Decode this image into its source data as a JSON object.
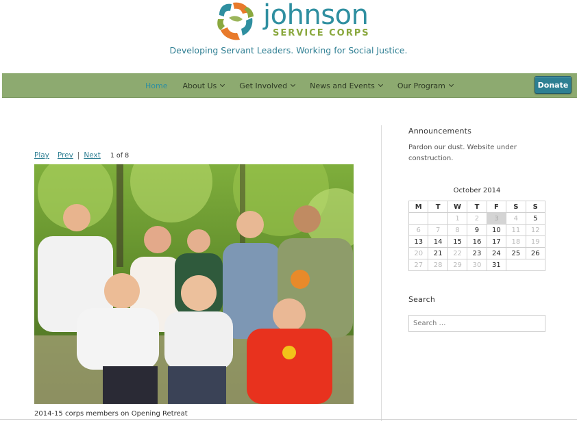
{
  "header": {
    "logo_name": "johnson",
    "logo_sub": "SERVICE CORPS",
    "tagline": "Developing Servant Leaders. Working for Social Justice.",
    "colors": {
      "teal": "#2f8fa0",
      "green": "#8aa83e",
      "orange": "#e87a2b",
      "nav": "#8daa70"
    }
  },
  "nav": {
    "items": [
      {
        "label": "Home",
        "active": true
      },
      {
        "label": "About Us"
      },
      {
        "label": "Get Involved"
      },
      {
        "label": "News and Events"
      },
      {
        "label": "Our Program"
      }
    ],
    "donate_label": "Donate"
  },
  "slideshow": {
    "play": "Play",
    "prev": "Prev",
    "sep": "|",
    "next": "Next",
    "counter": "1 of 8",
    "caption": "2014-15 corps members on Opening Retreat"
  },
  "sidebar": {
    "announcements_title": "Announcements",
    "announcements_text": "Pardon our dust. Website under construction.",
    "calendar": {
      "caption": "October  2014",
      "days": [
        "M",
        "T",
        "W",
        "T",
        "F",
        "S",
        "S"
      ],
      "weeks": [
        [
          "",
          "",
          "1",
          "2",
          "3",
          "4",
          "5"
        ],
        [
          "6",
          "7",
          "8",
          "9",
          "10",
          "11",
          "12"
        ],
        [
          "13",
          "14",
          "15",
          "16",
          "17",
          "18",
          "19"
        ],
        [
          "20",
          "21",
          "22",
          "23",
          "24",
          "25",
          "26"
        ],
        [
          "27",
          "28",
          "29",
          "30",
          "31",
          "",
          ""
        ]
      ]
    },
    "search_title": "Search",
    "search_placeholder": "Search …"
  }
}
